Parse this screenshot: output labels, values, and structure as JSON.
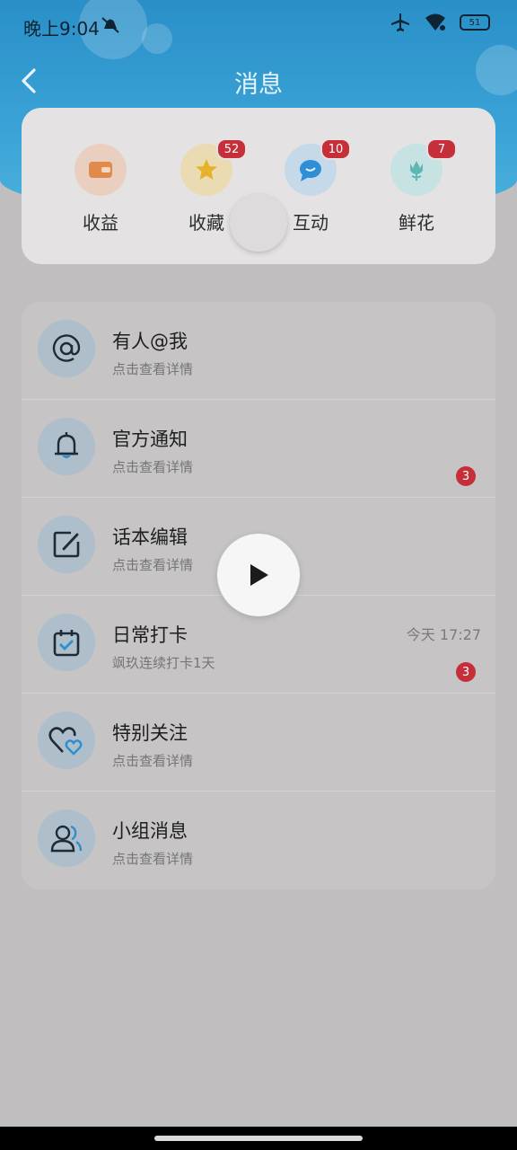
{
  "status_bar": {
    "time": "晚上9:04",
    "battery": "51"
  },
  "nav": {
    "title": "消息"
  },
  "quick_actions": [
    {
      "label": "收益",
      "icon": "wallet-icon",
      "badge": null,
      "color": "#e08a4c"
    },
    {
      "label": "收藏",
      "icon": "star-icon",
      "badge": "52",
      "color": "#e6b22c"
    },
    {
      "label": "互动",
      "icon": "chat-bubble-icon",
      "badge": "10",
      "color": "#2f8fd6"
    },
    {
      "label": "鲜花",
      "icon": "flower-icon",
      "badge": "7",
      "color": "#5bb8b4"
    }
  ],
  "messages": [
    {
      "title": "有人@我",
      "subtitle": "点击查看详情",
      "icon": "at-sign-icon"
    },
    {
      "title": "官方通知",
      "subtitle": "点击查看详情",
      "icon": "bell-icon",
      "badge": "3"
    },
    {
      "title": "话本编辑",
      "subtitle": "点击查看详情",
      "icon": "edit-icon"
    },
    {
      "title": "日常打卡",
      "subtitle": "飒玖连续打卡1天",
      "icon": "calendar-check-icon",
      "time": "今天 17:27",
      "badge": "3"
    },
    {
      "title": "特别关注",
      "subtitle": "点击查看详情",
      "icon": "hearts-icon"
    },
    {
      "title": "小组消息",
      "subtitle": "点击查看详情",
      "icon": "group-icon"
    }
  ],
  "colors": {
    "header": "#2f98cf",
    "badge": "#c62f39",
    "accent_blue": "#2d8fd0"
  }
}
